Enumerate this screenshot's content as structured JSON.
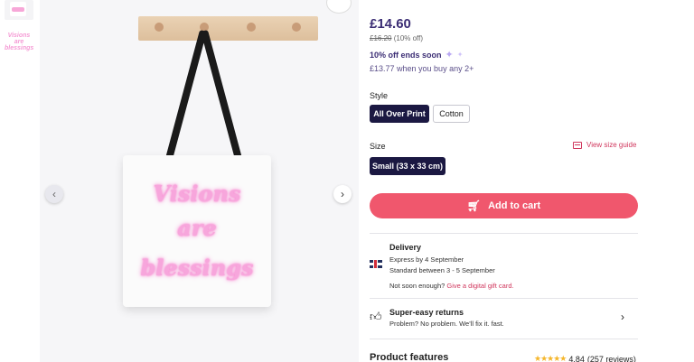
{
  "thumbnails": {
    "second_text": "Visions are blessings"
  },
  "product": {
    "bag_lines": [
      "Visions",
      "are",
      "blessings"
    ]
  },
  "nav": {
    "prev_glyph": "‹",
    "next_glyph": "›"
  },
  "pricing": {
    "price": "£14.60",
    "old_price": "£16.20",
    "discount": "(10% off)",
    "offer": "10% off ends soon",
    "multi_buy": "£13.77 when you buy any 2+"
  },
  "style": {
    "label": "Style",
    "options": [
      "All Over Print",
      "Cotton"
    ],
    "selected": "All Over Print"
  },
  "size": {
    "label": "Size",
    "guide_label": "View size guide",
    "options": [
      "Small (33 x 33 cm)"
    ],
    "selected": "Small (33 x 33 cm)"
  },
  "cart": {
    "label": "Add to cart"
  },
  "delivery": {
    "title": "Delivery",
    "express": "Express by 4 September",
    "standard": "Standard between 3 - 5 September",
    "not_soon": "Not soon enough?",
    "gift_link": "Give a digital gift card."
  },
  "returns": {
    "title": "Super-easy returns",
    "subtitle": "Problem? No problem. We'll fix it. fast."
  },
  "features": {
    "title": "Product features",
    "rating": "4.84",
    "reviews": "(257 reviews)"
  },
  "colors": {
    "brand_dark": "#1b1842",
    "accent_price": "#3b2d74",
    "cart": "#f0576d",
    "link": "#d0375d",
    "stars": "#f5b62a"
  }
}
